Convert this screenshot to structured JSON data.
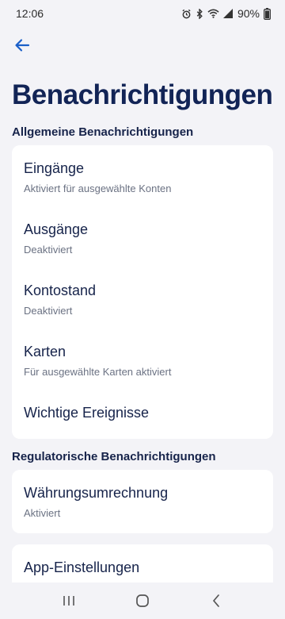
{
  "status_bar": {
    "time": "12:06",
    "battery": "90%",
    "icons": [
      "alarm-icon",
      "bluetooth-icon",
      "wifi-icon",
      "signal-icon",
      "battery-icon"
    ]
  },
  "header": {
    "back_icon": "arrow-left-icon",
    "title": "Benachrichtigungen"
  },
  "sections": [
    {
      "title": "Allgemeine Benachrichtigungen",
      "items": [
        {
          "label": "Eingänge",
          "sublabel": "Aktiviert für ausgewählte Konten"
        },
        {
          "label": "Ausgänge",
          "sublabel": "Deaktiviert"
        },
        {
          "label": "Kontostand",
          "sublabel": "Deaktiviert"
        },
        {
          "label": "Karten",
          "sublabel": "Für ausgewählte Karten aktiviert"
        },
        {
          "label": "Wichtige Ereignisse"
        }
      ]
    },
    {
      "title": "Regulatorische Benachrichtigungen",
      "items": [
        {
          "label": "Währungsumrechnung",
          "sublabel": "Aktiviert"
        }
      ]
    }
  ],
  "extra": {
    "app_settings_label": "App-Einstellungen"
  },
  "nav_bar": {
    "icons": [
      "recent-apps-icon",
      "home-icon",
      "back-nav-icon"
    ]
  },
  "colors": {
    "accent": "#1a5fc8",
    "title": "#122456",
    "background": "#f3f3f7",
    "card": "#ffffff",
    "subtext": "#6b7283"
  }
}
